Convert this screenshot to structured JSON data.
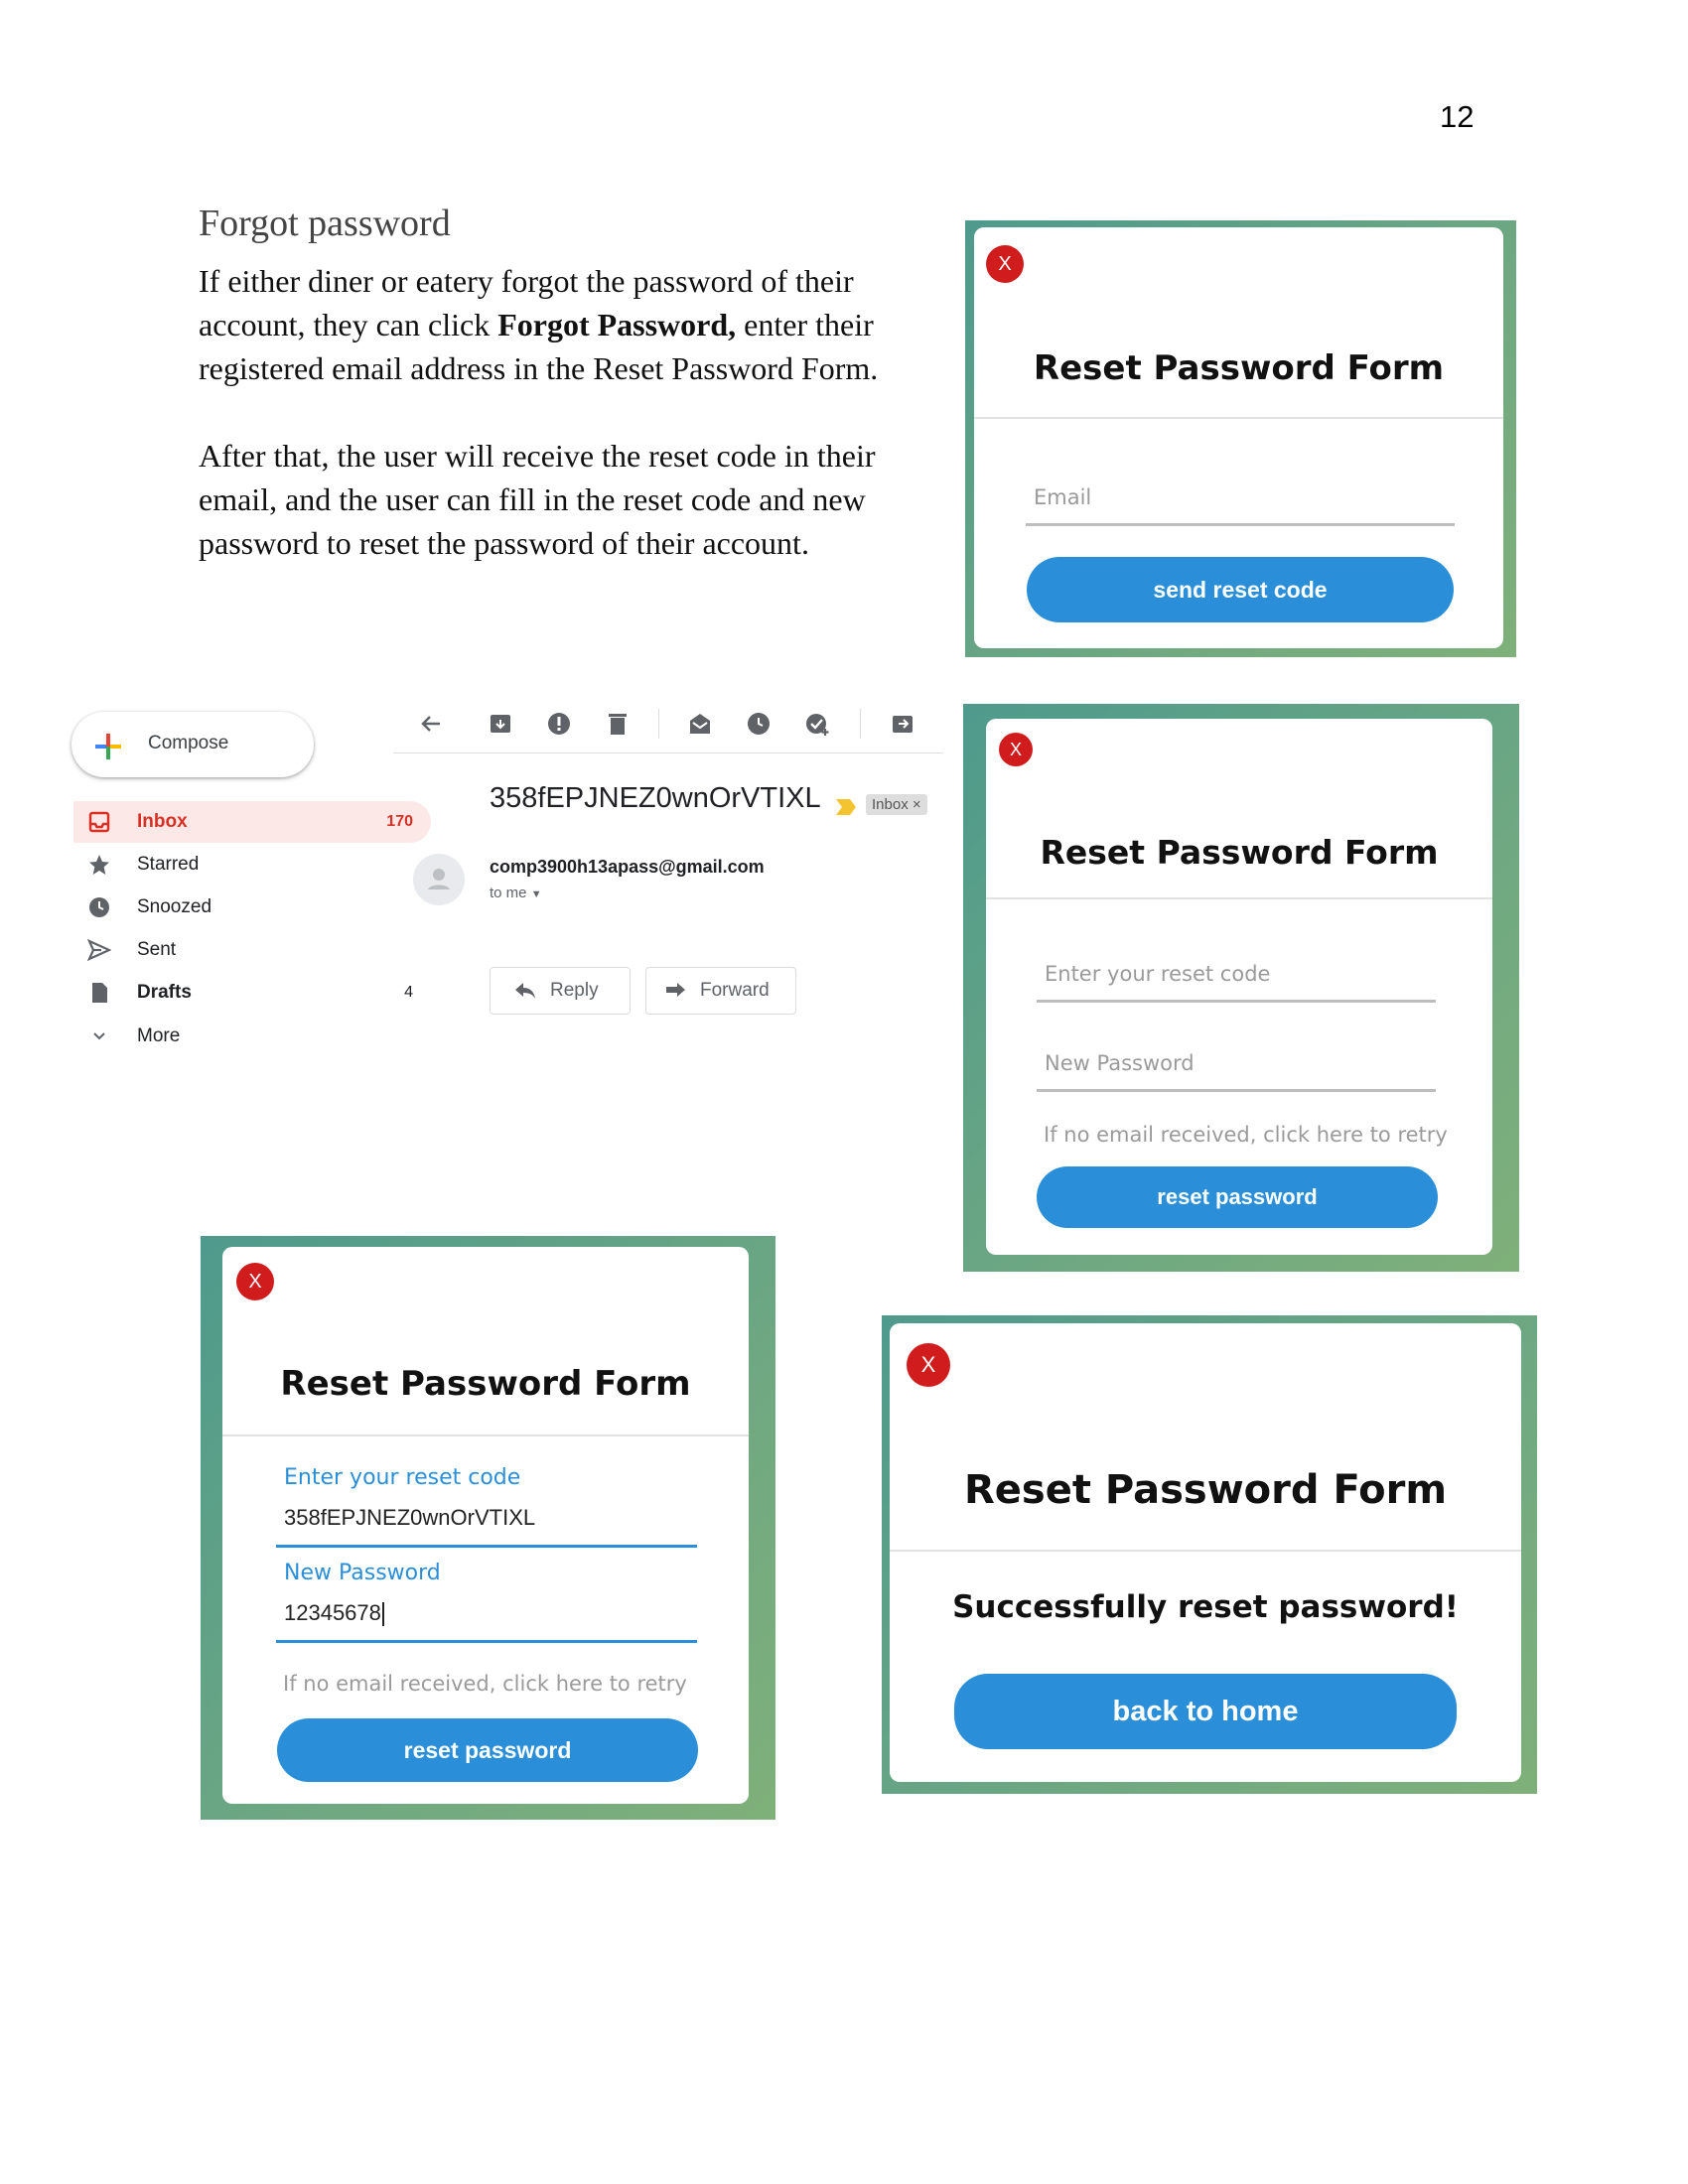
{
  "page_number": "12",
  "section": {
    "heading": "Forgot password",
    "para1_a": "If either diner or eatery forgot the password of their account, they can click ",
    "para1_bold": "Forgot Password,",
    "para1_b": " enter their registered email address in the Reset Password Form.",
    "para2": "After that, the user will receive the reset code in their email, and the user can fill in the reset code and new password to reset the password of their account."
  },
  "form1": {
    "close": "X",
    "title": "Reset Password Form",
    "email_placeholder": "Email",
    "button": "send reset code"
  },
  "gmail": {
    "compose": "Compose",
    "nav": [
      {
        "label": "Inbox",
        "count": "170",
        "icon": "inbox-icon"
      },
      {
        "label": "Starred",
        "count": "",
        "icon": "star-icon"
      },
      {
        "label": "Snoozed",
        "count": "",
        "icon": "clock-icon"
      },
      {
        "label": "Sent",
        "count": "",
        "icon": "send-icon"
      },
      {
        "label": "Drafts",
        "count": "4",
        "icon": "draft-icon"
      },
      {
        "label": "More",
        "count": "",
        "icon": "chevron-down-icon"
      }
    ],
    "subject": "358fEPJNEZ0wnOrVTIXL",
    "label_tag": "Inbox",
    "label_close": "×",
    "sender": "comp3900h13apass@gmail.com",
    "to": "to me",
    "reply": "Reply",
    "forward": "Forward"
  },
  "form2": {
    "close": "X",
    "title": "Reset Password Form",
    "code_placeholder": "Enter your reset code",
    "password_placeholder": "New Password",
    "retry": "If no email received, click here to retry",
    "button": "reset password"
  },
  "form3": {
    "close": "X",
    "title": "Reset Password Form",
    "code_label": "Enter your reset code",
    "code_value": "358fEPJNEZ0wnOrVTIXL",
    "password_label": "New Password",
    "password_value": "12345678",
    "retry": "If no email received, click here to retry",
    "button": "reset password"
  },
  "form4": {
    "close": "X",
    "title": "Reset Password Form",
    "message": "Successfully reset password!",
    "button": "back to home"
  },
  "colors": {
    "accent": "#2a8fd8",
    "close": "#d01c1c",
    "frame": "#5e9f87",
    "gmail_red": "#d93025"
  }
}
